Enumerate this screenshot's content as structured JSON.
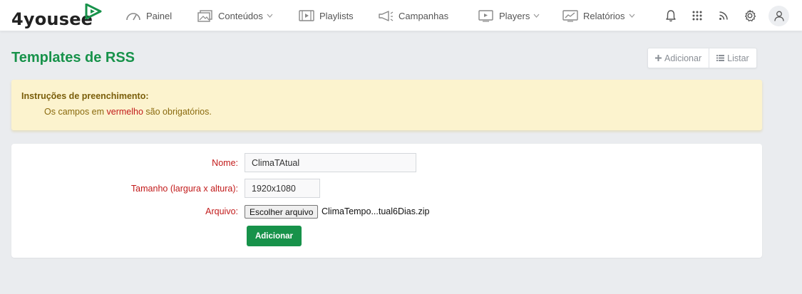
{
  "app": {
    "logo_text": "4yousee",
    "brand_color": "#17924a"
  },
  "nav": {
    "items": [
      {
        "label": "Painel",
        "icon": "gauge-icon",
        "has_dropdown": false
      },
      {
        "label": "Conteúdos",
        "icon": "images-icon",
        "has_dropdown": true
      },
      {
        "label": "Playlists",
        "icon": "playlist-icon",
        "has_dropdown": false
      },
      {
        "label": "Campanhas",
        "icon": "megaphone-icon",
        "has_dropdown": false
      },
      {
        "label": "Players",
        "icon": "player-icon",
        "has_dropdown": true
      },
      {
        "label": "Relatórios",
        "icon": "chart-icon",
        "has_dropdown": true
      }
    ],
    "right_icons": [
      "bell-icon",
      "apps-grid-icon",
      "rss-icon",
      "gear-icon",
      "user-icon"
    ]
  },
  "page": {
    "title": "Templates de RSS",
    "actions": {
      "add_label": "Adicionar",
      "list_label": "Listar"
    }
  },
  "alert": {
    "title": "Instruções de preenchimento:",
    "text_before": "Os campos em ",
    "text_highlight": "vermelho",
    "text_after": " são obrigatórios."
  },
  "form": {
    "name_label": "Nome:",
    "name_value": "ClimaTAtual",
    "size_label": "Tamanho (largura x altura):",
    "size_value": "1920x1080",
    "file_label": "Arquivo:",
    "file_button_label": "Escolher arquivo",
    "file_name": "ClimaTempo...tual6Dias.zip",
    "submit_label": "Adicionar"
  }
}
